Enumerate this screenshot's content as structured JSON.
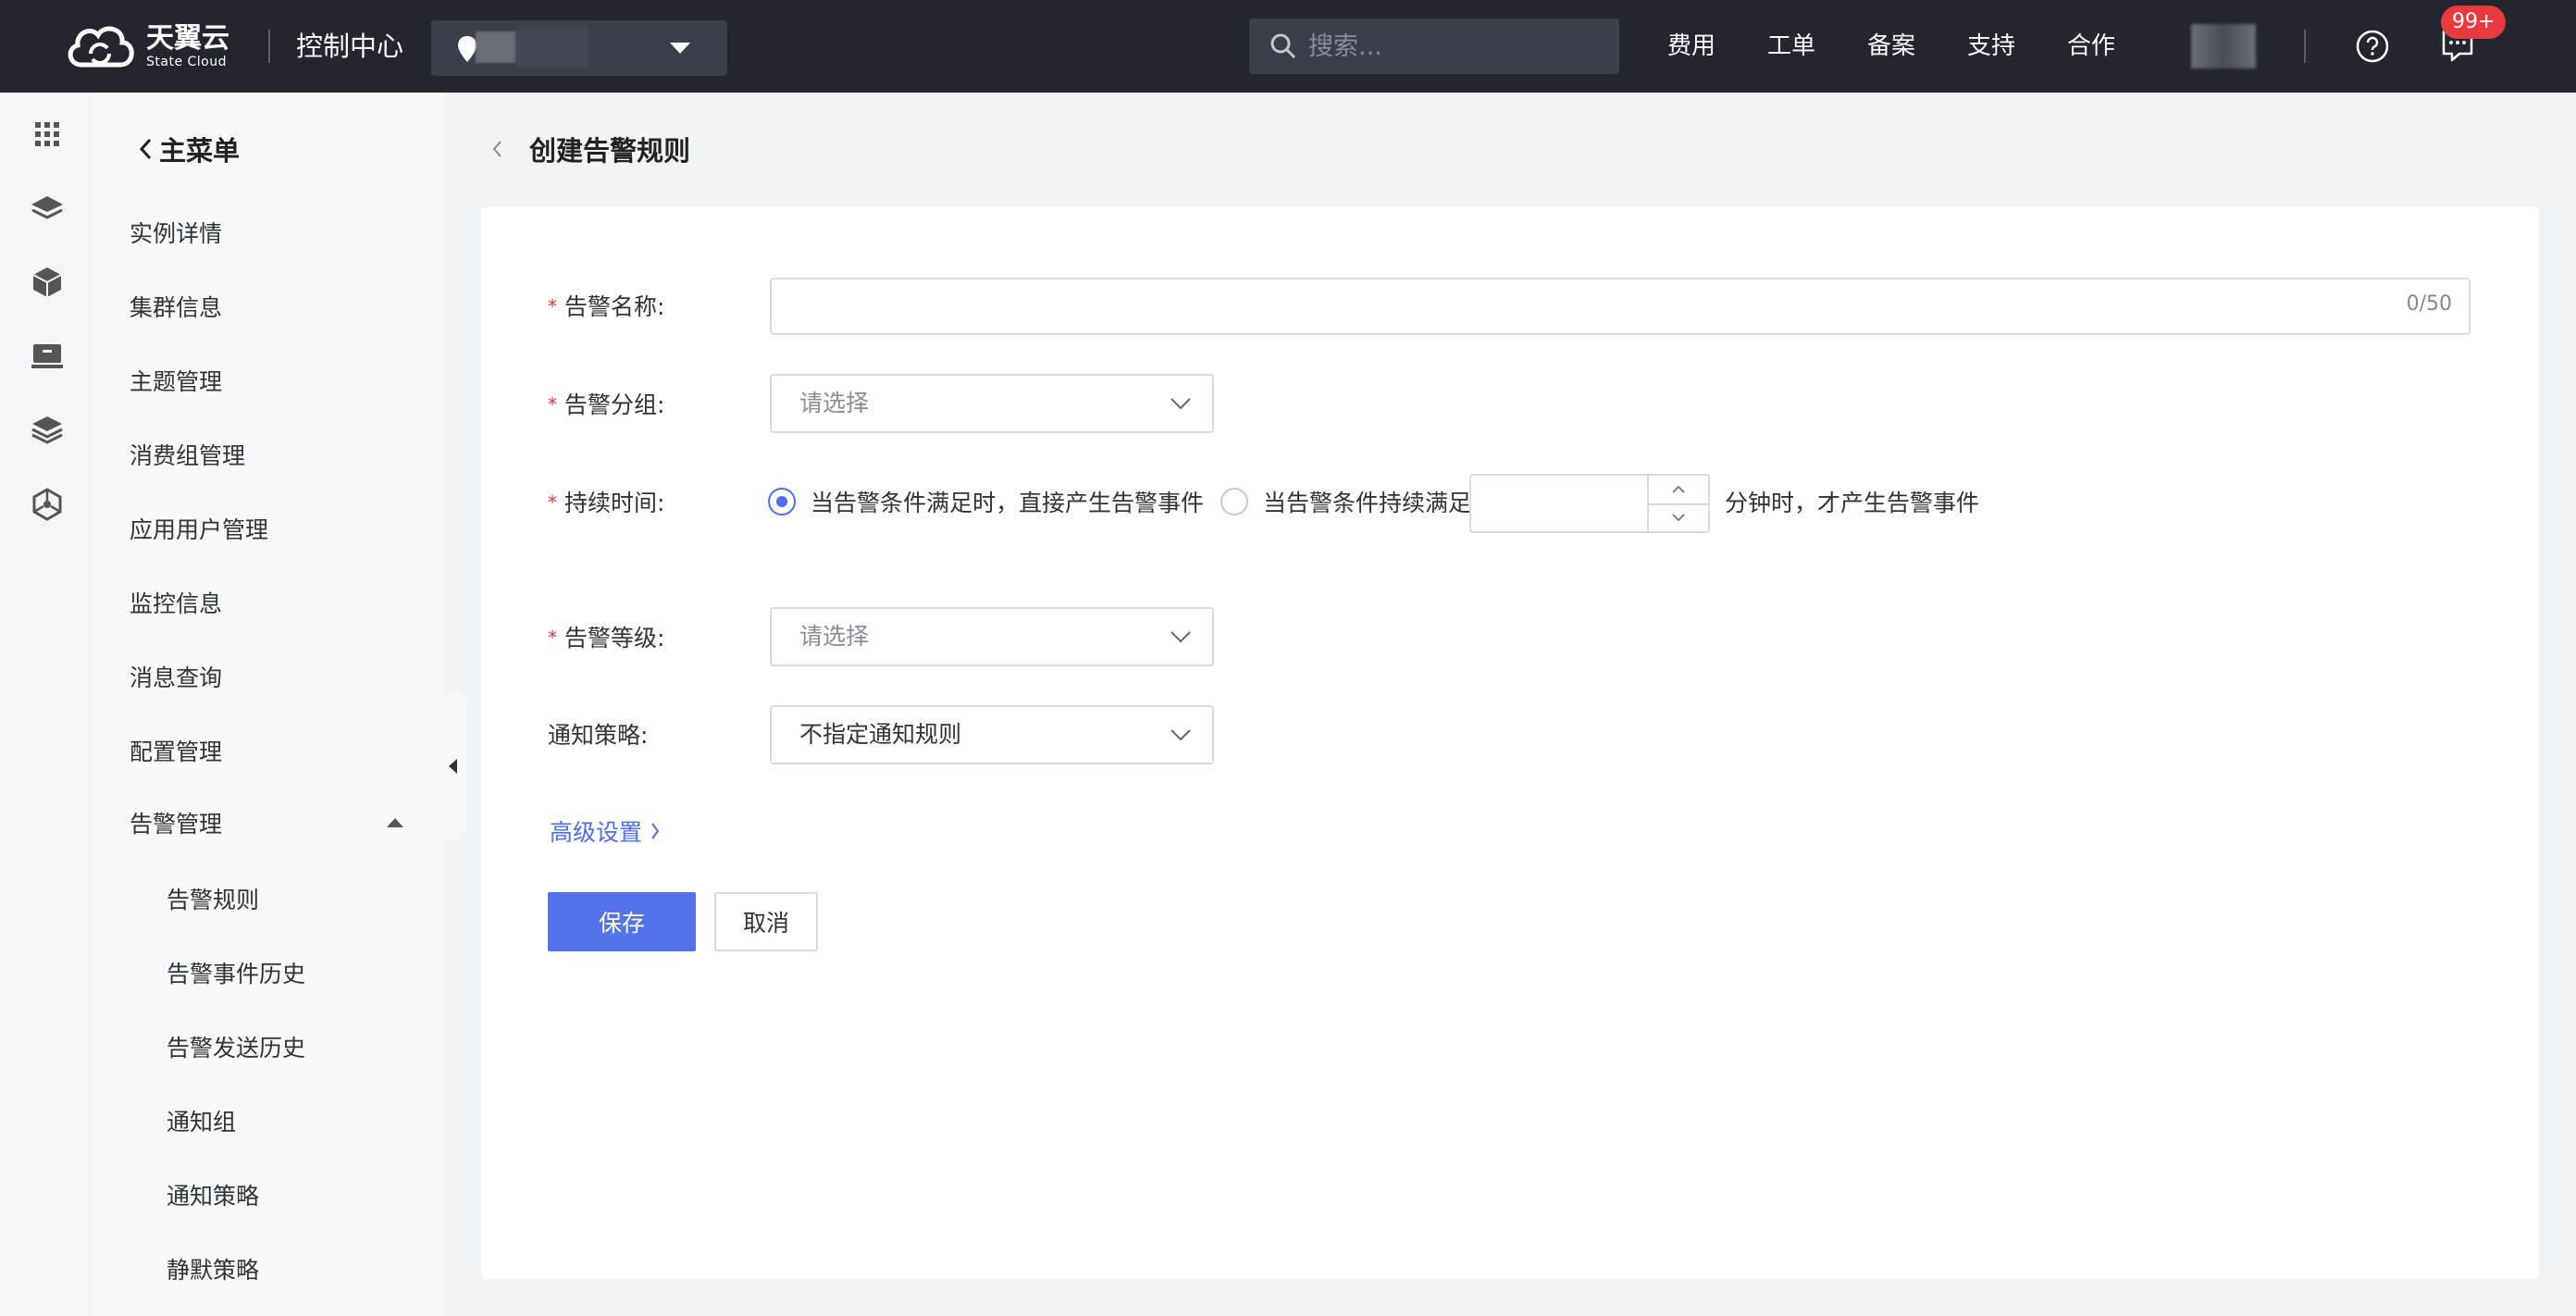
{
  "brand": {
    "name_cn": "天翼云",
    "name_en": "State Cloud"
  },
  "header": {
    "console_title": "控制中心",
    "search_placeholder": "搜索...",
    "nav": [
      "费用",
      "工单",
      "备案",
      "支持",
      "合作"
    ],
    "notification_badge": "99+"
  },
  "rail_icons": [
    "apps-grid-icon",
    "layers-icon",
    "cube-icon",
    "monitor-icon",
    "stack-icon",
    "network-icon"
  ],
  "sidebar": {
    "back_label": "主菜单",
    "items": [
      "实例详情",
      "集群信息",
      "主题管理",
      "消费组管理",
      "应用用户管理",
      "监控信息",
      "消息查询",
      "配置管理",
      "告警管理"
    ],
    "sub_items": [
      "告警规则",
      "告警事件历史",
      "告警发送历史",
      "通知组",
      "通知策略",
      "静默策略"
    ]
  },
  "page": {
    "title": "创建告警规则"
  },
  "form": {
    "name_label": "告警名称:",
    "name_value": "",
    "name_counter": "0/50",
    "group_label": "告警分组:",
    "group_placeholder": "请选择",
    "duration_label": "持续时间:",
    "duration_option1": "当告警条件满足时，直接产生告警事件",
    "duration_option2": "当告警条件持续满足",
    "duration_minutes": "",
    "duration_suffix": "分钟时，才产生告警事件",
    "level_label": "告警等级:",
    "level_placeholder": "请选择",
    "notify_label": "通知策略:",
    "notify_value": "不指定通知规则",
    "advanced_link": "高级设置",
    "save_label": "保存",
    "cancel_label": "取消"
  },
  "colors": {
    "topbar": "#23252f",
    "primary": "#5473e8",
    "required": "#e8393c",
    "badge": "#e8393c"
  }
}
